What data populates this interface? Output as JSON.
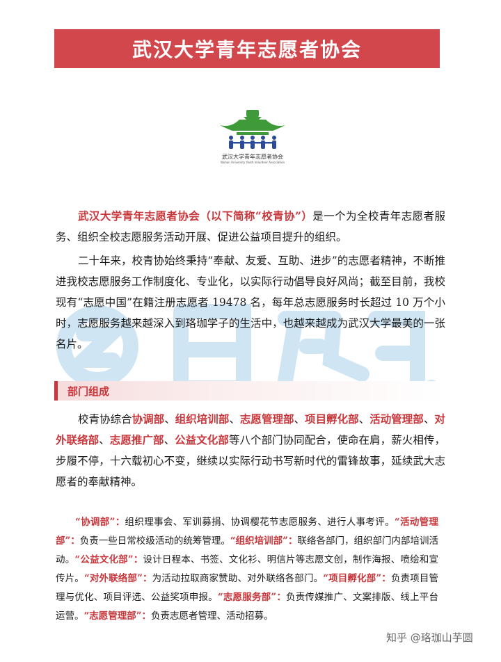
{
  "title": "武汉大学青年志愿者协会",
  "logo": {
    "name_text": "武汉大学青年志愿者协会",
    "english_text": "Wuhan University Youth Volunteer Association",
    "colors": {
      "roof": "#3f9b3a",
      "people": "#2b4a9a"
    }
  },
  "intro": {
    "p1_highlight": "武汉大学青年志愿者协会（以下简称“校青协”）",
    "p1_rest": "是一个为全校青年志愿者服务、组织全校志愿服务活动开展、促进公益项目提升的组织。",
    "p2": "二十年来，校青协始终秉持“奉献、友爱、互助、进步”的志愿者精神，不断推进我校志愿服务工作制度化、专业化，以实际行动倡导良好风尚；截至目前，我校现有“志愿中国”在籍注册志愿者 19478 名，每年总志愿服务时长超过 10 万个小时，志愿服务越来越深入到珞珈学子的生活中，也越来越成为武汉大学最美的一张名片。"
  },
  "section": {
    "title": "部门组成"
  },
  "structure": {
    "lead": "校青协综合",
    "departments": [
      "协调部",
      "组织培训部",
      "志愿管理部",
      "项目孵化部",
      "活动管理部",
      "对外联络部",
      "志愿推广部",
      "公益文化部"
    ],
    "sep": "、",
    "tail": "等八个部门协同配合，使命在肩，薪火相传，步履不停，十六载初心不变，继续以实际行动书写新时代的雷锋故事，延续武大志愿者的奉献精神。"
  },
  "duties": [
    {
      "name": "“协调部”：",
      "desc": "组织理事会、军训募捐、协调樱花节志愿服务、进行人事考评。"
    },
    {
      "name": "“活动管理部”：",
      "desc": "负责一些日常校级活动的统筹管理。"
    },
    {
      "name": "“组织培训部”：",
      "desc": "联络各部门，组织部门内部培训活动。"
    },
    {
      "name": "“公益文化部”：",
      "desc": "设计日程本、书签、文化衫、明信片等志愿文创，制作海报、喷绘和宣传片。"
    },
    {
      "name": "“对外联络部”：",
      "desc": "为活动拉取商家赞助、对外联络各部门。"
    },
    {
      "name": "“项目孵化部”：",
      "desc": "负责项目管理与优化、项目评选、公益奖项申报。"
    },
    {
      "name": "“志愿服务部”：",
      "desc": "负责传媒推广、文案排版、线上平台运营。"
    },
    {
      "name": "“志愿管理部”：",
      "desc": "负责志愿者管理、活动招募。"
    }
  ],
  "credit": "知乎 @珞珈山芋圆",
  "accent_color": "#c8373c"
}
